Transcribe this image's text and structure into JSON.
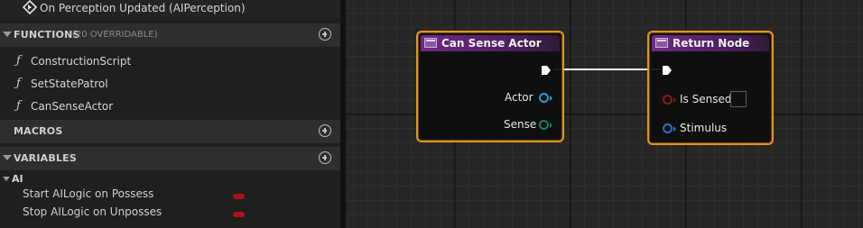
{
  "event_item": {
    "label": "On Perception Updated (AIPerception)",
    "icon": "event-icon"
  },
  "functions": {
    "title": "FUNCTIONS",
    "subtitle": "(20 OVERRIDABLE)",
    "items": [
      {
        "label": "ConstructionScript"
      },
      {
        "label": "SetStatePatrol"
      },
      {
        "label": "CanSenseActor"
      }
    ]
  },
  "macros": {
    "title": "MACROS"
  },
  "variables": {
    "title": "VARIABLES",
    "category": "AI",
    "items": [
      {
        "label": "Start AILogic on Possess",
        "type_color": "#b3101a"
      },
      {
        "label": "Stop AILogic on Unposses",
        "type_color": "#b3101a"
      }
    ]
  },
  "graph": {
    "nodes": [
      {
        "title": "Can Sense Actor",
        "pins": [
          {
            "label": "Actor"
          },
          {
            "label": "Sense"
          }
        ]
      },
      {
        "title": "Return Node",
        "pins": [
          {
            "label": "Is Sensed",
            "checked": false
          },
          {
            "label": "Stimulus"
          }
        ]
      }
    ]
  },
  "colors": {
    "node_border": "#e0951c",
    "header_purple": "#6f2a86",
    "bool_pin": "#8d1818",
    "object_pin": "#2f9ad8",
    "struct_pin": "#1f7a7a"
  }
}
